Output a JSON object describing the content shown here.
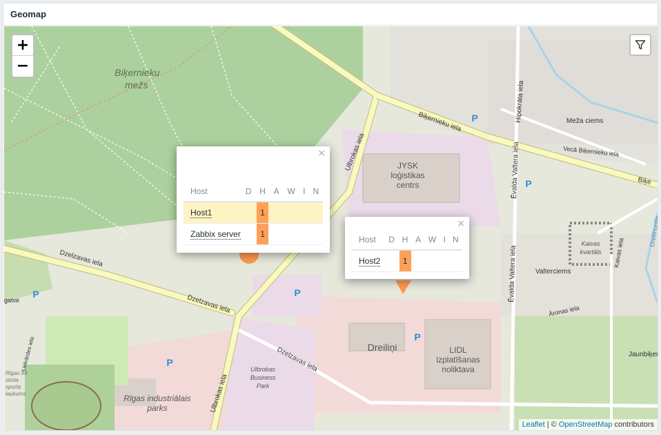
{
  "widget": {
    "title": "Geomap"
  },
  "zoom": {
    "in_label": "+",
    "out_label": "−"
  },
  "map_labels": {
    "forest": "Biķernieku",
    "forest2": "mežs",
    "street1": "Biķernieku iela",
    "street2": "Ulbrokas iela",
    "street3": "Dzelzavas iela",
    "street4": "Dzelzavas iela",
    "street5": "Dzelzavas iela",
    "street6": "Ulbrokas iela",
    "street7": "Hipokrāta iela",
    "street8": "Ēvalda Valtera iela",
    "street9": "Ēvalda Valtera iela",
    "street10": "Vecā Biķernieku iela",
    "street11": "Biķe",
    "jysk1": "JYSK",
    "jysk2": "loģistikas",
    "jysk3": "centrs",
    "lidl1": "LIDL",
    "lidl2": "izplatīšanas",
    "lidl3": "noliktava",
    "dreilini": "Dreiliņi",
    "park1": "Rīgas industriālais",
    "park2": "parks",
    "bpark1": "Ulbrokas",
    "bpark2": "Business",
    "bpark3": "Park",
    "kvartals1": "Kaivas",
    "kvartals2": "kvartāls",
    "meza": "Meža ciems",
    "valterciems": "Valterciems",
    "aronas": "Āronas iela",
    "kaivas": "Kaivas iela",
    "jaunbiker": "Jaunbiķer",
    "dreilinupite": "Dreilinupīte",
    "lieivardes": "Lielvārdes iela",
    "gatve": "gatve",
    "p": "P",
    "school1": "Rīgas 84",
    "school2": "skola",
    "school3": "sporta",
    "school4": "laukums"
  },
  "popup1": {
    "headers": {
      "host": "Host",
      "d": "D",
      "h": "H",
      "a": "A",
      "w": "W",
      "i": "I",
      "n": "N"
    },
    "rows": [
      {
        "host": "Host1",
        "h": "1"
      },
      {
        "host": "Zabbix server",
        "h": "1"
      }
    ],
    "close": "×"
  },
  "popup2": {
    "headers": {
      "host": "Host",
      "d": "D",
      "h": "H",
      "a": "A",
      "w": "W",
      "i": "I",
      "n": "N"
    },
    "rows": [
      {
        "host": "Host2",
        "h": "1"
      }
    ],
    "close": "×"
  },
  "attribution": {
    "leaflet": "Leaflet",
    "sep": " | © ",
    "osm": "OpenStreetMap",
    "contrib": " contributors"
  },
  "colors": {
    "high_severity": "#ffa059",
    "highlight_row": "#fef3c3",
    "forest": "#add19e",
    "industrial": "#ebdbe8",
    "commercial": "#f2dad9",
    "road_primary": "#fcd6a4",
    "road_secondary": "#f7fabf"
  }
}
